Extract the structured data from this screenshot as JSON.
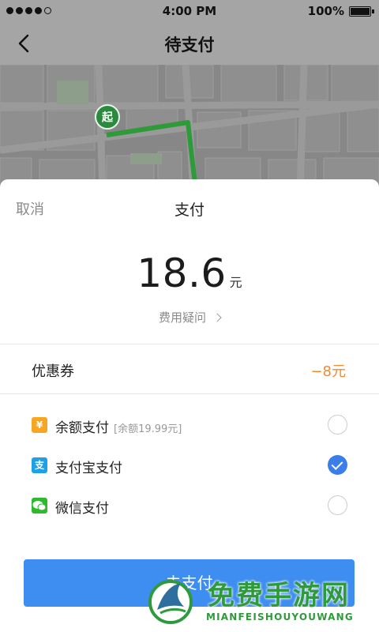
{
  "status_bar": {
    "time": "4:00 PM",
    "battery": "100%",
    "battery_level": 1.0,
    "signal_bars_filled": 4,
    "signal_bars_total": 5
  },
  "nav": {
    "title": "待支付"
  },
  "map": {
    "start_marker": "起",
    "route_color": "#2e9a3a"
  },
  "sheet": {
    "cancel_label": "取消",
    "title": "支付",
    "amount": "18.6",
    "currency": "元",
    "fee_question": "费用疑问"
  },
  "coupon": {
    "label": "优惠券",
    "value": "−8元"
  },
  "payment_options": [
    {
      "icon": "balance-icon",
      "icon_glyph": "¥",
      "icon_color": "#f5a623",
      "label": "余额支付",
      "note": "[余额19.99元]",
      "checked": false
    },
    {
      "icon": "alipay-icon",
      "icon_glyph": "支",
      "icon_color": "#1e9fe8",
      "label": "支付宝支付",
      "note": "",
      "checked": true
    },
    {
      "icon": "wechat-icon",
      "icon_glyph": "●",
      "icon_color": "#2dbb2d",
      "label": "微信支付",
      "note": "",
      "checked": false
    }
  ],
  "confirm_button": {
    "label": "去支付"
  },
  "watermark": {
    "title": "免费手游网",
    "subtitle": "MIANFEISHOUYOUWANG"
  },
  "colors": {
    "accent": "#3e8df0",
    "coupon": "#f28a2e",
    "checked": "#3b7ee8"
  }
}
